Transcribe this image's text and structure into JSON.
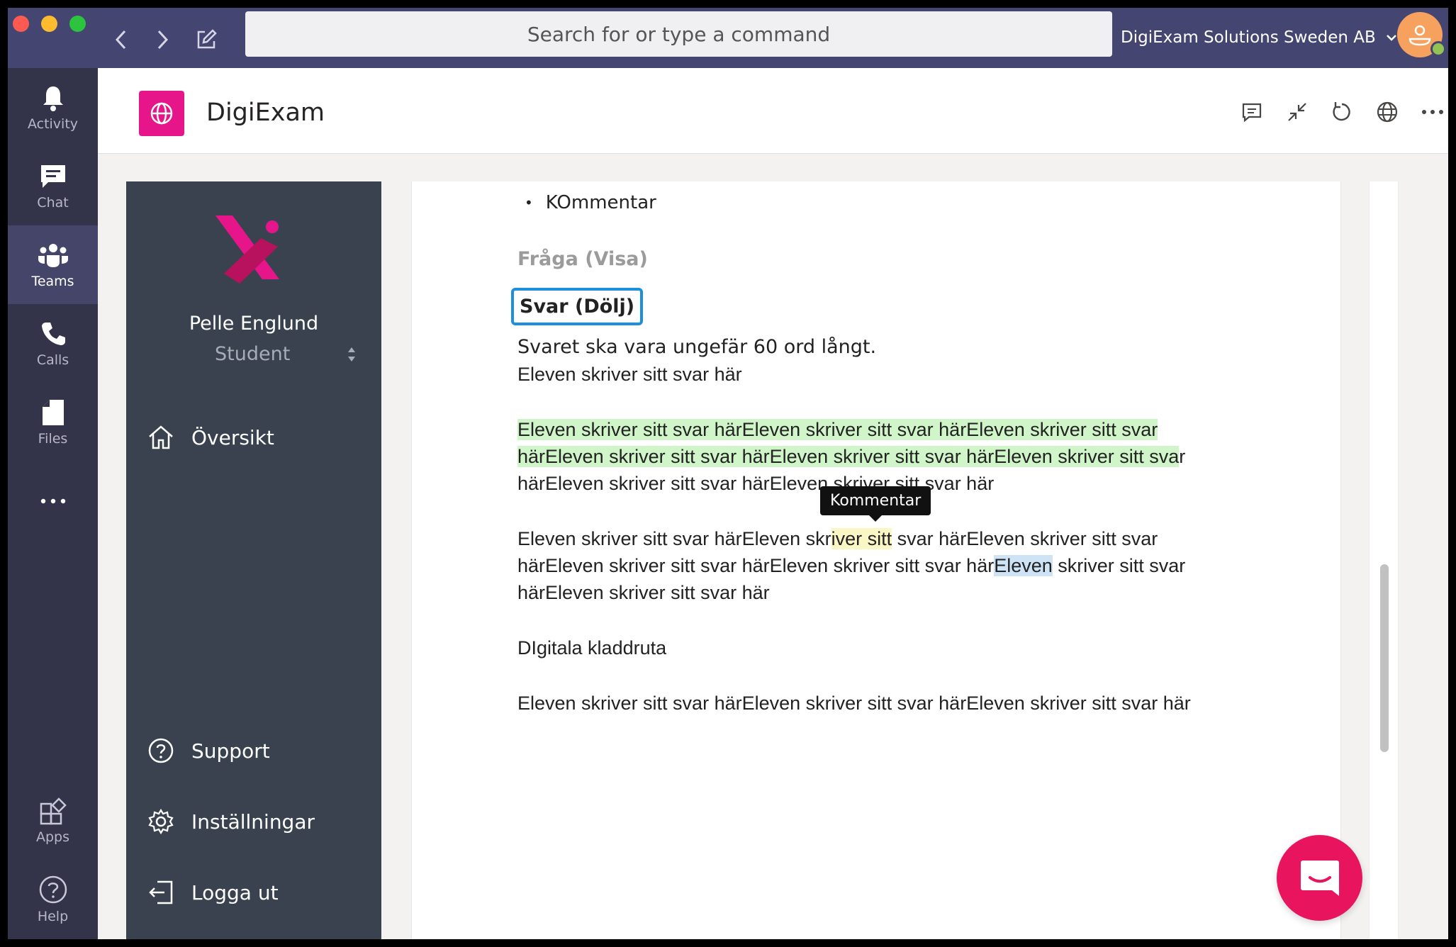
{
  "titlebar": {
    "search_placeholder": "Search for or type a command",
    "org_name": "DigiExam Solutions Sweden AB"
  },
  "rail": {
    "items": [
      {
        "label": "Activity",
        "icon": "bell-icon"
      },
      {
        "label": "Chat",
        "icon": "chat-icon"
      },
      {
        "label": "Teams",
        "icon": "teams-icon",
        "active": true
      },
      {
        "label": "Calls",
        "icon": "phone-icon"
      },
      {
        "label": "Files",
        "icon": "file-icon"
      },
      {
        "label": "Apps",
        "icon": "apps-icon"
      },
      {
        "label": "Help",
        "icon": "help-icon"
      }
    ]
  },
  "app": {
    "name": "DigiExam",
    "brand_color": "#e6168a"
  },
  "sidebar": {
    "user_name": "Pelle Englund",
    "user_role": "Student",
    "nav": {
      "overview": "Översikt",
      "support": "Support",
      "settings": "Inställningar",
      "logout": "Logga ut"
    }
  },
  "document": {
    "bullet": "KOmmentar",
    "question_label": "Fråga (Visa)",
    "answer_label": "Svar (Dölj)",
    "instruction": "Svaret ska vara ungefär 60 ord långt.",
    "answer_line": "Eleven skriver sitt svar här",
    "p1_line1": "Eleven skriver sitt svar härEleven skriver sitt svar härEleven skriver sitt svar",
    "p1_line2": "härEleven skriver sitt svar härEleven skriver sitt svar härEleven skriver sitt sva",
    "p1_line2_tail": "r",
    "p1_line3": "härEleven skriver sitt svar härEleven skriver sitt svar här",
    "tooltip": "Kommentar",
    "p2_line1_a": "Eleven skriver sitt svar härEleven skr",
    "p2_line1_hl": "iver sitt",
    "p2_line1_b": " svar härEleven skriver sitt svar",
    "p2_line2_a": "härEleven skriver sitt svar härEleven skriver sitt svar här",
    "p2_line2_hl": "Eleven",
    "p2_line2_b": " skriver sitt svar",
    "p2_line3": "härEleven skriver sitt svar här",
    "scratch_heading": "DIgitala kladdruta",
    "scratch_text": "Eleven skriver sitt svar härEleven skriver sitt svar härEleven skriver sitt svar här"
  },
  "colors": {
    "titlebar": "#454572",
    "rail": "#33344a",
    "sidebar": "#39424e",
    "highlight_green": "#d0f5c9",
    "highlight_yellow": "#fbf6c5",
    "highlight_blue": "#cfe3f7",
    "chat_fab": "#e8155e"
  }
}
